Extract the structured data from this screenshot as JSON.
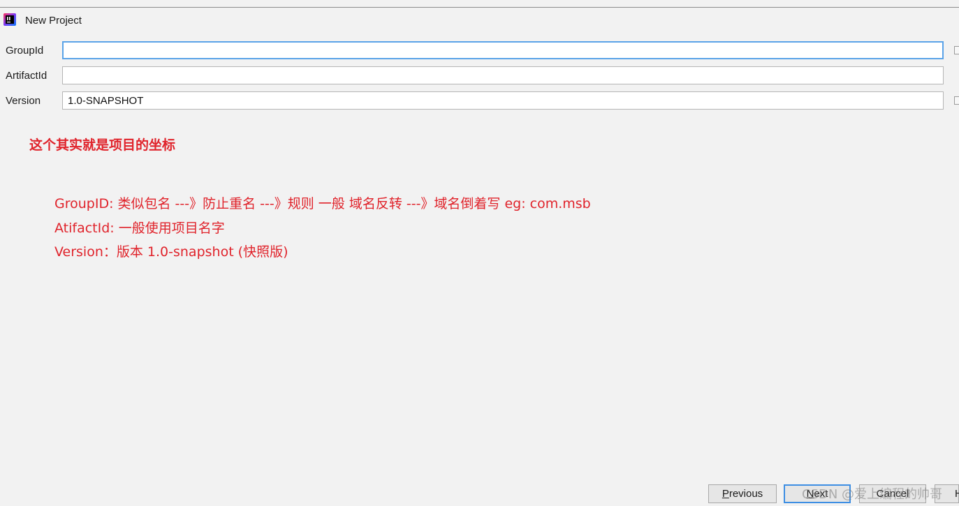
{
  "window": {
    "title": "New Project",
    "icon": "intellij-idea-icon"
  },
  "form": {
    "group_id": {
      "label": "GroupId",
      "value": ""
    },
    "artifact_id": {
      "label": "ArtifactId",
      "value": ""
    },
    "version": {
      "label": "Version",
      "value": "1.0-SNAPSHOT"
    }
  },
  "annotation": {
    "heading": "这个其实就是项目的坐标",
    "lines": [
      "GroupID: 类似包名  ---》防止重名  ---》规则 一般  域名反转 ---》域名倒着写    eg:  com.msb",
      "AtifactId:  一般使用项目名字",
      "Version：版本   1.0-snapshot  (快照版)"
    ],
    "color": "#e0232b"
  },
  "buttons": {
    "previous": {
      "mnemonic": "P",
      "rest": "revious"
    },
    "next": {
      "mnemonic": "N",
      "rest": "ext"
    },
    "cancel": {
      "label": "Cancel"
    },
    "help": {
      "label": "H"
    }
  },
  "watermark": "CSDN @爱上编程的帅哥",
  "colors": {
    "background": "#f2f2f2",
    "focus_border": "#5aa3e8",
    "default_button_border": "#3d8ee3"
  }
}
